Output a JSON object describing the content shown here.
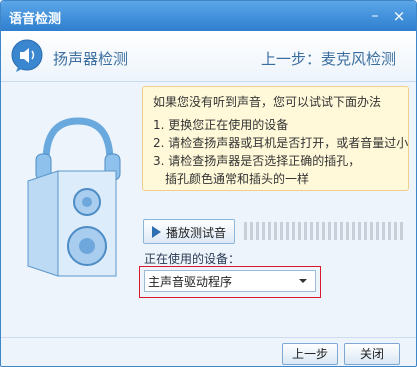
{
  "window": {
    "title": "语音检测"
  },
  "titlebar_buttons": {
    "minimize": "–",
    "close": "×"
  },
  "header": {
    "title": "扬声器检测",
    "back_link": "上一步：麦克风检测"
  },
  "info": {
    "heading": "如果您没有听到声音，您可以试试下面办法",
    "items": [
      "1. 更换您正在使用的设备",
      "2. 请检查扬声器或耳机是否打开，或者音量过小",
      "3. 请检查扬声器是否选择正确的插孔，",
      "插孔颜色通常和插头的一样"
    ]
  },
  "play_button": {
    "label": "播放测试音"
  },
  "level_meter": {
    "level": 0
  },
  "device": {
    "label": "正在使用的设备：",
    "selected": "主声音驱动程序"
  },
  "footer": {
    "back_button": "上一步",
    "close_button": "关闭"
  },
  "colors": {
    "titlebar": "#2f7fcf",
    "accent": "#3b6e9f",
    "info_bg": "#fff8d9",
    "highlight": "#d9192e"
  }
}
